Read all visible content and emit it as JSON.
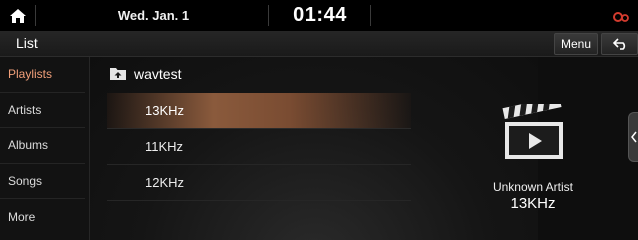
{
  "status_bar": {
    "date": "Wed. Jan. 1",
    "time": "01:44",
    "icons": {
      "home": "home-icon",
      "status": "phone-link-icon"
    },
    "accent_color": "#d23b2e"
  },
  "header": {
    "title": "List",
    "menu_label": "Menu",
    "back_icon": "back-arrow-icon"
  },
  "sidebar": {
    "active_index": 0,
    "active_color": "#f2a07a",
    "items": [
      {
        "label": "Playlists"
      },
      {
        "label": "Artists"
      },
      {
        "label": "Albums"
      },
      {
        "label": "Songs"
      },
      {
        "label": "More"
      }
    ]
  },
  "list": {
    "folder": {
      "icon": "folder-up-icon",
      "label": "wavtest"
    },
    "selected_index": 0,
    "tracks": [
      {
        "label": "13KHz"
      },
      {
        "label": "11KHz"
      },
      {
        "label": "12KHz"
      }
    ]
  },
  "now_playing": {
    "artwork_icon": "clapperboard-play-icon",
    "artist": "Unknown Artist",
    "title": "13KHz"
  },
  "side_handle_icon": "chevron-left-icon"
}
